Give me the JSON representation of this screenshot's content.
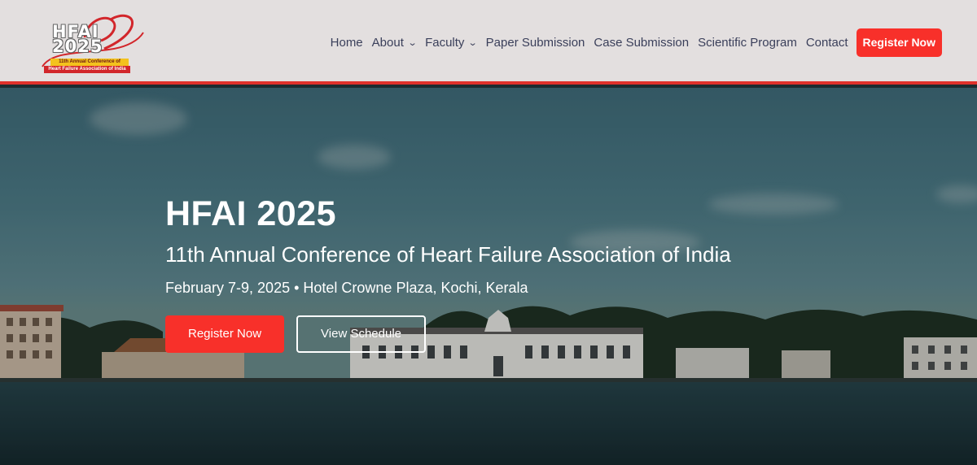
{
  "logo": {
    "line1": "HFAI",
    "line2": "2025",
    "band1": "11th Annual Conference of",
    "band2": "Heart Failure Association of India"
  },
  "nav": {
    "items": [
      {
        "label": "Home",
        "dropdown": false
      },
      {
        "label": "About",
        "dropdown": true
      },
      {
        "label": "Faculty",
        "dropdown": true
      },
      {
        "label": "Paper Submission",
        "dropdown": false
      },
      {
        "label": "Case Submission",
        "dropdown": false
      },
      {
        "label": "Scientific Program",
        "dropdown": false
      },
      {
        "label": "Contact",
        "dropdown": false
      }
    ],
    "cta": "Register Now"
  },
  "hero": {
    "title": "HFAI 2025",
    "subtitle": "11th Annual Conference of Heart Failure Association of India",
    "meta": "February 7-9, 2025 • Hotel Crowne Plaza, Kochi, Kerala",
    "primary_button": "Register Now",
    "secondary_button": "View Schedule"
  },
  "colors": {
    "accent": "#f8302a",
    "header_bg": "#e3dfdf",
    "nav_text": "#3a3f5a"
  }
}
